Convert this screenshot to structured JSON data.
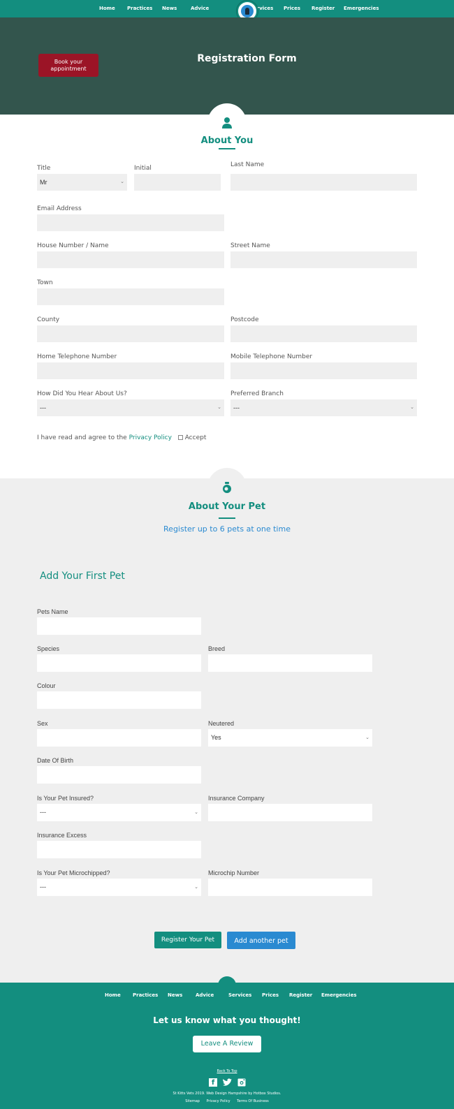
{
  "nav": {
    "left": [
      "Home",
      "Practices",
      "News",
      "Advice"
    ],
    "right": [
      "Services",
      "Prices",
      "Register",
      "Emergencies"
    ],
    "logo_alt": "St Kitts Veterinary Group logo"
  },
  "hero": {
    "book_line1": "Book your",
    "book_line2": "appointment",
    "title": "Registration Form"
  },
  "about_you": {
    "icon": "person-icon",
    "title": "About You",
    "fields": {
      "title_label": "Title",
      "title_value": "Mr",
      "initial_label": "Initial",
      "last_name_label": "Last Name",
      "email_label": "Email Address",
      "house_label": "House Number / Name",
      "street_label": "Street Name",
      "town_label": "Town",
      "county_label": "County",
      "postcode_label": "Postcode",
      "home_tel_label": "Home Telephone Number",
      "mobile_tel_label": "Mobile Telephone Number",
      "hear_label": "How Did You Hear About Us?",
      "hear_value": "---",
      "branch_label": "Preferred Branch",
      "branch_value": "---"
    },
    "privacy_text": "I have read and agree to the",
    "privacy_link": "Privacy Policy",
    "accept_label": "Accept"
  },
  "about_pet": {
    "icon": "pet-bowl-icon",
    "title": "About Your Pet",
    "subtitle": "Register up to 6 pets at one time",
    "add_first": "Add Your First Pet",
    "fields": {
      "name_label": "Pets Name",
      "species_label": "Species",
      "breed_label": "Breed",
      "colour_label": "Colour",
      "sex_label": "Sex",
      "neutered_label": "Neutered",
      "neutered_value": "Yes",
      "dob_label": "Date Of Birth",
      "insured_label": "Is Your Pet Insured?",
      "insured_value": "---",
      "ins_company_label": "Insurance Company",
      "ins_excess_label": "Insurance Excess",
      "chipped_label": "Is Your Pet Microchipped?",
      "chipped_value": "---",
      "chip_number_label": "Microchip Number"
    },
    "register_button": "Register Your Pet",
    "add_another_button": "Add another pet"
  },
  "footer": {
    "nav": [
      "Home",
      "Practices",
      "News",
      "Advice",
      "Services",
      "Prices",
      "Register",
      "Emergencies"
    ],
    "feedback_title": "Let us know what you thought!",
    "review_button": "Leave A Review",
    "back_to_top": "Back To Top",
    "social": [
      "facebook-icon",
      "twitter-icon",
      "instagram-icon"
    ],
    "copyright": "St Kitts Vets 2019. Web Design Hampshire by Hotbox Studios.",
    "links": [
      "Sitemap",
      "Privacy Policy",
      "Terms Of Business"
    ]
  },
  "colors": {
    "brand_teal": "#138e7f",
    "hero_bg": "#33554d",
    "book_red": "#9b1426",
    "accent_blue": "#2a8ad1"
  }
}
